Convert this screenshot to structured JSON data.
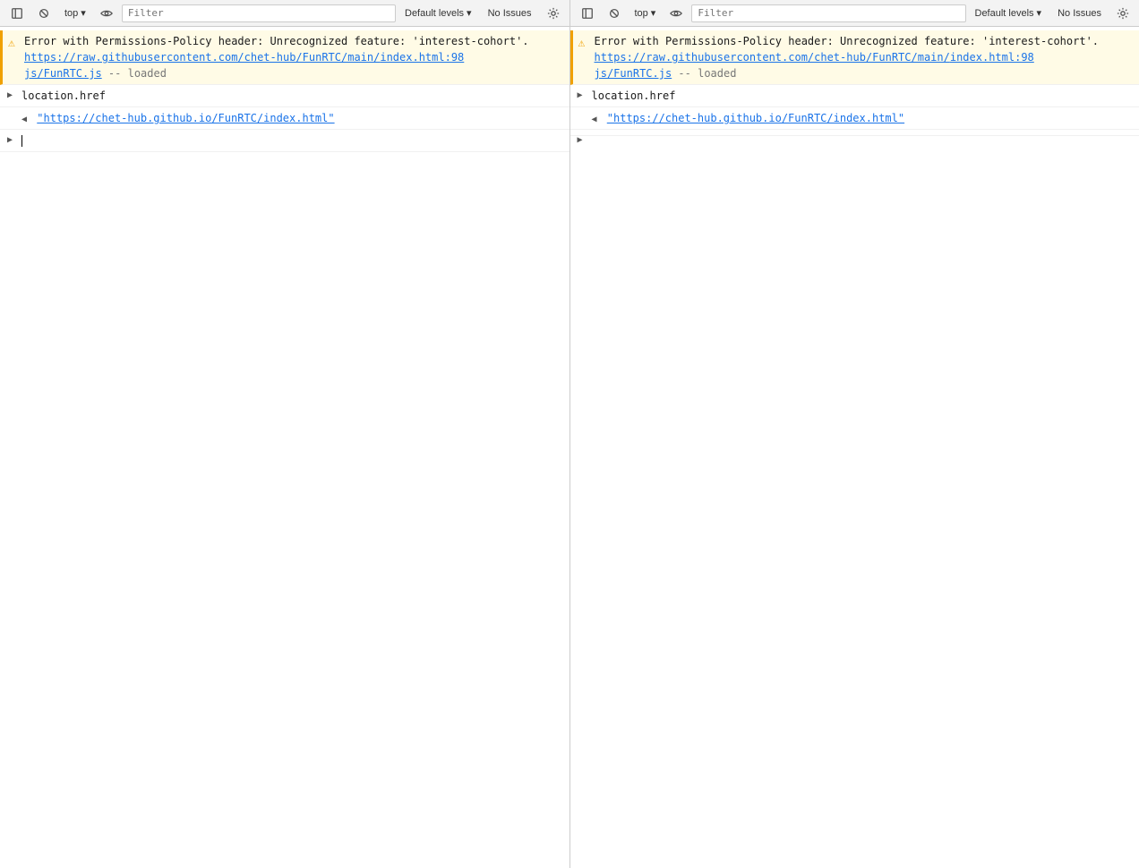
{
  "panels": [
    {
      "id": "left",
      "toolbar": {
        "pause_label": "",
        "no_breakpoints_label": "",
        "context_label": "top",
        "eye_label": "",
        "filter_placeholder": "Filter",
        "levels_label": "Default levels",
        "no_issues_label": "No Issues",
        "settings_label": ""
      },
      "entries": [
        {
          "type": "warning",
          "text": "Error with Permissions-Policy header: Unrecognized feature: 'interest-cohort'.",
          "link1": "https://raw.githubusercontent.com/chet-hub/FunRTC/main/",
          "link2": "index.html:98",
          "link3": "js/FunRTC.js",
          "source": "-- loaded"
        },
        {
          "type": "expandable-right",
          "text": "location.href"
        },
        {
          "type": "string-result",
          "link": "\"https://chet-hub.github.io/FunRTC/index.html\""
        },
        {
          "type": "cursor"
        }
      ]
    },
    {
      "id": "right",
      "toolbar": {
        "pause_label": "",
        "no_breakpoints_label": "",
        "context_label": "top",
        "eye_label": "",
        "filter_placeholder": "Filter",
        "levels_label": "Default levels",
        "no_issues_label": "No Issues",
        "settings_label": ""
      },
      "entries": [
        {
          "type": "warning",
          "text": "Error with Permissions-Policy header: Unrecognized feature: 'interest-cohort'.",
          "link1": "https://raw.githubusercontent.com/chet-hub/FunRTC/main/",
          "link2": "index.html:98",
          "link3": "js/FunRTC.js",
          "source": "-- loaded"
        },
        {
          "type": "expandable-right",
          "text": "location.href"
        },
        {
          "type": "string-result",
          "link": "\"https://chet-hub.github.io/FunRTC/index.html\""
        },
        {
          "type": "cursor-empty"
        }
      ]
    }
  ]
}
